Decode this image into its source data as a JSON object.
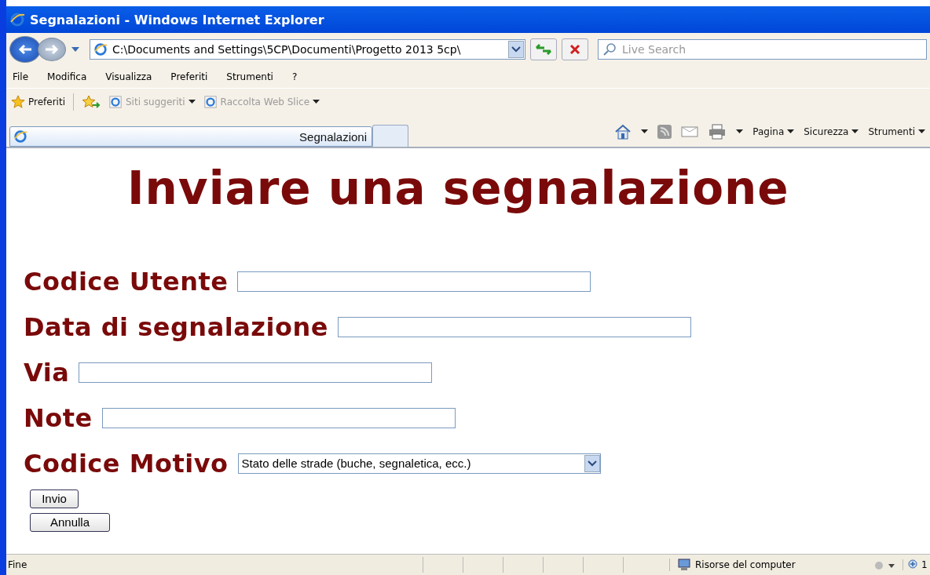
{
  "window": {
    "title": "Segnalazioni - Windows Internet Explorer"
  },
  "address_bar": {
    "value": "C:\\Documents and Settings\\5CP\\Documenti\\Progetto 2013 5cp\\"
  },
  "search": {
    "placeholder": "Live Search"
  },
  "menu": [
    "File",
    "Modifica",
    "Visualizza",
    "Preferiti",
    "Strumenti",
    "?"
  ],
  "favorites_bar": {
    "label": "Preferiti",
    "links": [
      {
        "label": "Siti suggeriti",
        "disabled": true
      },
      {
        "label": "Raccolta Web Slice",
        "disabled": true
      }
    ]
  },
  "tabs": [
    {
      "label": "Segnalazioni",
      "selected": true
    }
  ],
  "command_bar": [
    "Pagina",
    "Sicurezza",
    "Strumenti"
  ],
  "page": {
    "heading": "Inviare una segnalazione",
    "fields": [
      {
        "kind": "text",
        "label": "Codice Utente"
      },
      {
        "kind": "text",
        "label": "Data di segnalazione"
      },
      {
        "kind": "text",
        "label": "Via"
      },
      {
        "kind": "text",
        "label": "Note"
      },
      {
        "kind": "select",
        "label": "Codice Motivo",
        "value": "Stato delle strade (buche, segnaletica, ecc.)"
      }
    ],
    "buttons": [
      "Invio",
      "Annulla"
    ]
  },
  "status_bar": {
    "text": "Fine",
    "zone": "Risorse del computer",
    "zoom": "1"
  }
}
